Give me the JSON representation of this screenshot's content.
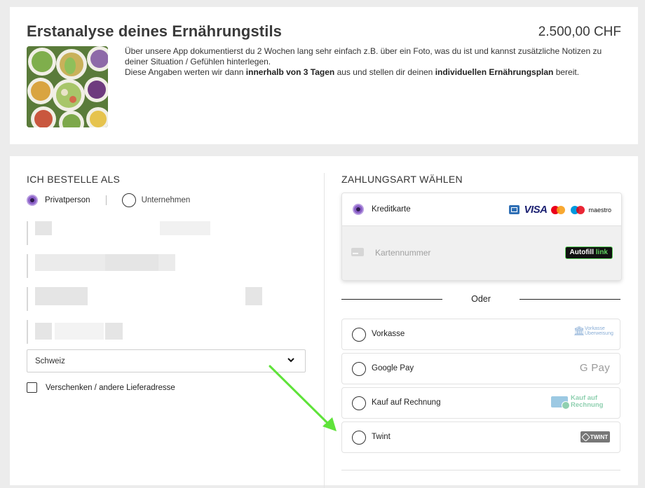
{
  "product": {
    "title": "Erstanalyse deines Ernährungstils",
    "price": "2.500,00 CHF",
    "desc_line1": "Über unsere App dokumentierst du 2 Wochen lang sehr einfach z.B. über ein Foto, was du ist und kannst zusätzliche Notizen zu deiner Situation / Gefühlen hinterlegen.",
    "desc_line2_a": "Diese Angaben werten wir dann ",
    "desc_line2_b": "innerhalb von 3 Tagen",
    "desc_line2_c": " aus und stellen dir deinen ",
    "desc_line2_d": "individuellen Ernährungsplan",
    "desc_line2_e": " bereit."
  },
  "order": {
    "section_title": "ICH BESTELLE ALS",
    "type_private": "Privatperson",
    "type_company": "Unternehmen",
    "country": "Schweiz",
    "gift_label": "Verschenken / andere Lieferadresse"
  },
  "payment": {
    "section_title": "ZAHLUNGSART WÄHLEN",
    "credit_card_label": "Kreditkarte",
    "card_number_placeholder": "Kartennummer",
    "autofill_a": "Autofill ",
    "autofill_b": "link",
    "visa": "VISA",
    "maestro": "maestro",
    "or_label": "Oder",
    "options": [
      {
        "label": "Vorkasse",
        "logo": "Vorkasse Überweisung"
      },
      {
        "label": "Google Pay",
        "logo": "G Pay"
      },
      {
        "label": "Kauf auf Rechnung",
        "logo": "Kauf auf Rechnung"
      },
      {
        "label": "Twint",
        "logo": "TWINT"
      }
    ]
  },
  "colors": {
    "radio_selected": "#8a5fc7",
    "arrow": "#5fe33a"
  },
  "icons": [
    "amex-icon",
    "visa-icon",
    "mastercard-icon",
    "maestro-icon",
    "card-icon",
    "bank-icon",
    "chevron-down-icon"
  ]
}
